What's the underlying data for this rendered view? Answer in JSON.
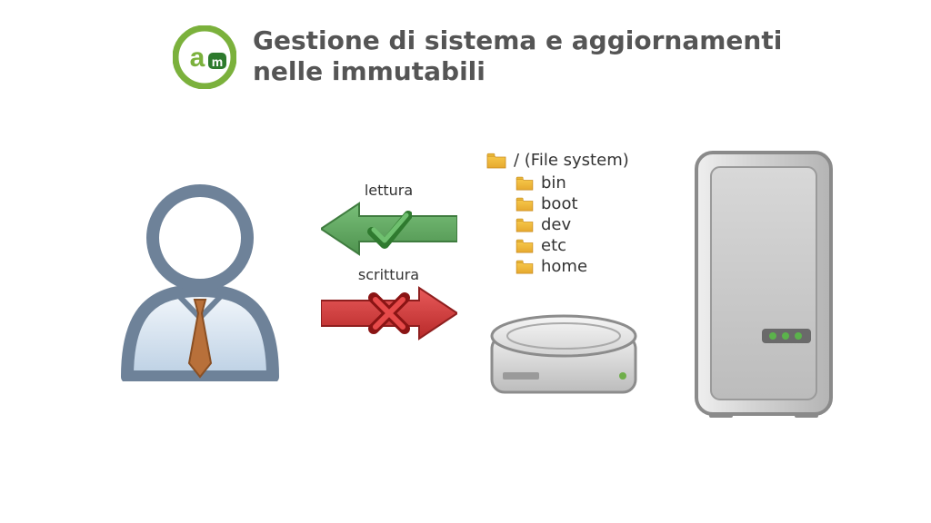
{
  "title": "Gestione di sistema e aggiornamenti nelle immutabili",
  "logo": {
    "letters": "am",
    "primary": "#7bb13c",
    "secondary": "#2d7a2d"
  },
  "arrows": {
    "read": {
      "label": "lettura",
      "color": "#5ea35e"
    },
    "write": {
      "label": "scrittura",
      "color": "#d43c3c"
    }
  },
  "filesystem": {
    "root_label": "/ (File system)",
    "folders": [
      "bin",
      "boot",
      "dev",
      "etc",
      "home"
    ]
  },
  "colors": {
    "folder_fill_top": "#f7c94a",
    "folder_fill_bottom": "#e6a92f",
    "user_outline": "#6e8299",
    "user_body_top": "#e8f0f8",
    "user_body_bottom": "#bcd0e4",
    "tie": "#b8703a",
    "drive_top": "#e4e4e4",
    "drive_bottom": "#bfbfbf",
    "server_top": "#e6e6e6",
    "server_bottom": "#b7b7b7",
    "server_leds": [
      "#5bb34b",
      "#5bb34b",
      "#5bb34b"
    ]
  }
}
